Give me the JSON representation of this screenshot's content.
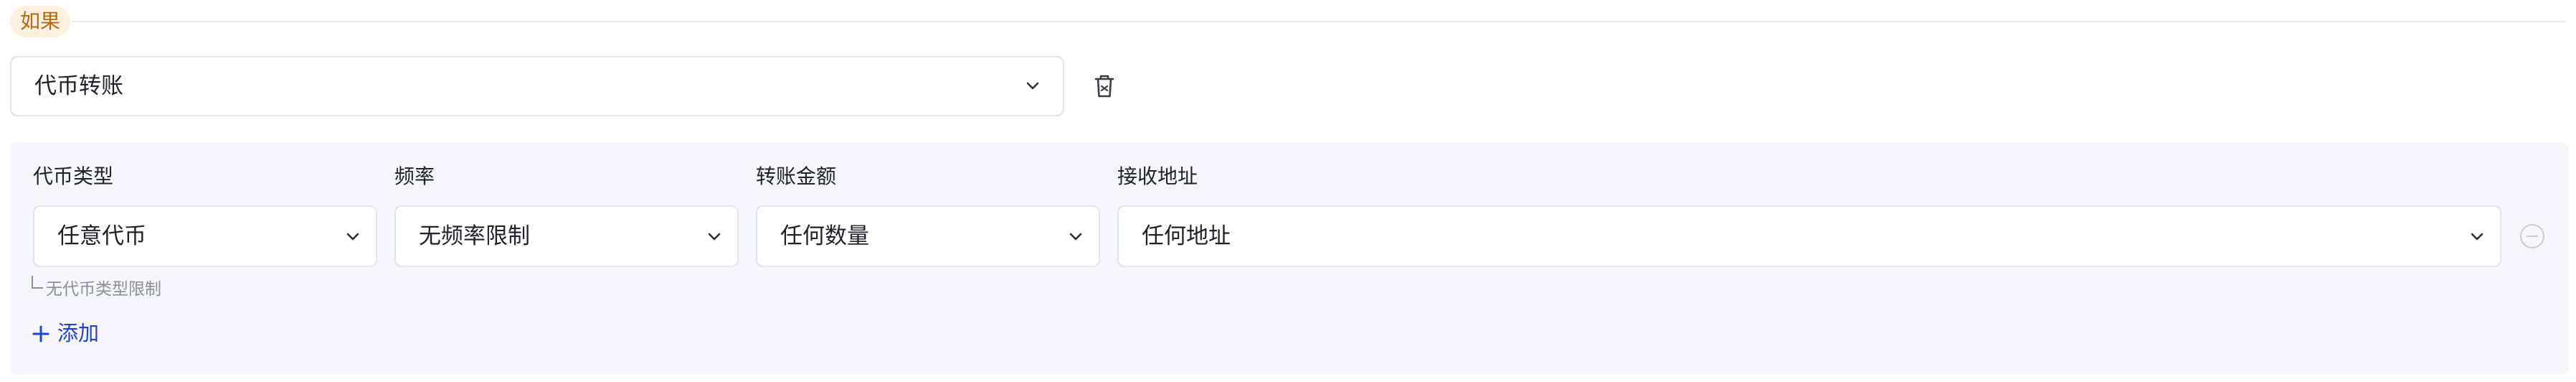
{
  "header": {
    "if_tag": "如果"
  },
  "condition": {
    "selected": "代币转账"
  },
  "columns": [
    {
      "label": "代币类型",
      "value": "任意代币"
    },
    {
      "label": "频率",
      "value": "无频率限制"
    },
    {
      "label": "转账金额",
      "value": "任何数量"
    },
    {
      "label": "接收地址",
      "value": "任何地址"
    }
  ],
  "hint": "无代币类型限制",
  "add_label": "添加",
  "colors": {
    "tag_bg": "#fdf0de",
    "tag_text": "#b36a12",
    "panel_bg": "#f5f6fa",
    "accent": "#2042c8",
    "border": "#e1e4e8"
  },
  "icons": {
    "dropdown": "chevron-down-icon",
    "delete": "trash-icon",
    "remove": "minus-circle-icon",
    "add": "plus-icon"
  }
}
